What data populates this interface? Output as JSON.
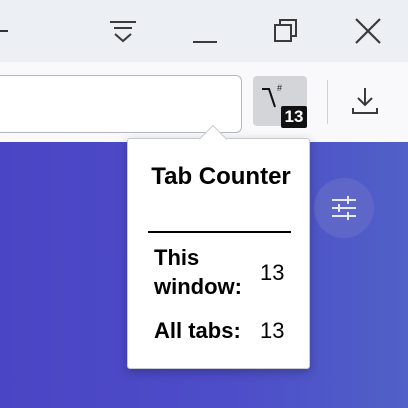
{
  "titlebar": {
    "buttons": [
      {
        "name": "list-all-tabs",
        "icon": "tab-list-chevron-icon"
      },
      {
        "name": "minimize",
        "icon": "minimize-icon"
      },
      {
        "name": "restore",
        "icon": "restore-icon"
      },
      {
        "name": "close",
        "icon": "close-icon"
      }
    ]
  },
  "toolbar": {
    "extension": {
      "icon": "tab-counter-icon",
      "badge": "13"
    },
    "download": {
      "icon": "download-icon"
    }
  },
  "page": {
    "fab_icon": "sliders-icon"
  },
  "popup": {
    "title": "Tab Counter",
    "this_window_label": "This window:",
    "this_window_value": "13",
    "all_tabs_label": "All tabs:",
    "all_tabs_value": "13"
  },
  "colors": {
    "titlebar_bg": "#eceff4",
    "toolbar_bg": "#f9f9fb",
    "extension_bg": "#d3d5d9",
    "content_gradient_start": "#4a45c4",
    "content_gradient_end": "#5061c8",
    "fab_bg": "#5e66c8"
  }
}
